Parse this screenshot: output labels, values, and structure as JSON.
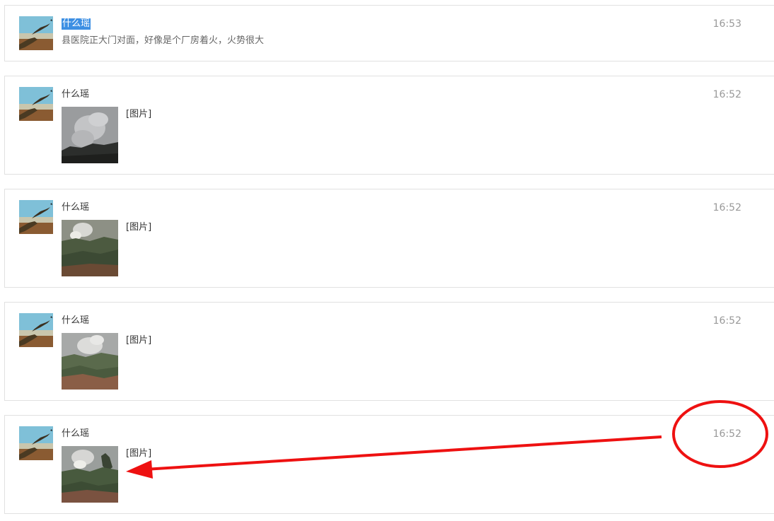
{
  "messages": [
    {
      "sender": "什么瑶",
      "text": "县医院正大门对面，好像是个厂房着火，火势很大",
      "time": "16:53",
      "selected_sender": true
    },
    {
      "sender": "什么瑶",
      "photo_label": "[图片]",
      "time": "16:52",
      "thumb_icon": "smoke-photo"
    },
    {
      "sender": "什么瑶",
      "photo_label": "[图片]",
      "time": "16:52",
      "thumb_icon": "fire-hillside-photo"
    },
    {
      "sender": "什么瑶",
      "photo_label": "[图片]",
      "time": "16:52",
      "thumb_icon": "fire-slope-photo"
    },
    {
      "sender": "什么瑶",
      "photo_label": "[图片]",
      "time": "16:52",
      "thumb_icon": "fire-valley-photo"
    }
  ],
  "avatar_icon": "eagle-landscape-avatar",
  "annotation": {
    "color": "#ee1111",
    "shapes": [
      "circle-around-time",
      "arrow-to-photo"
    ]
  },
  "colors": {
    "selection": "#3d8fe3",
    "border": "#e1e1e1",
    "time": "#999999"
  }
}
